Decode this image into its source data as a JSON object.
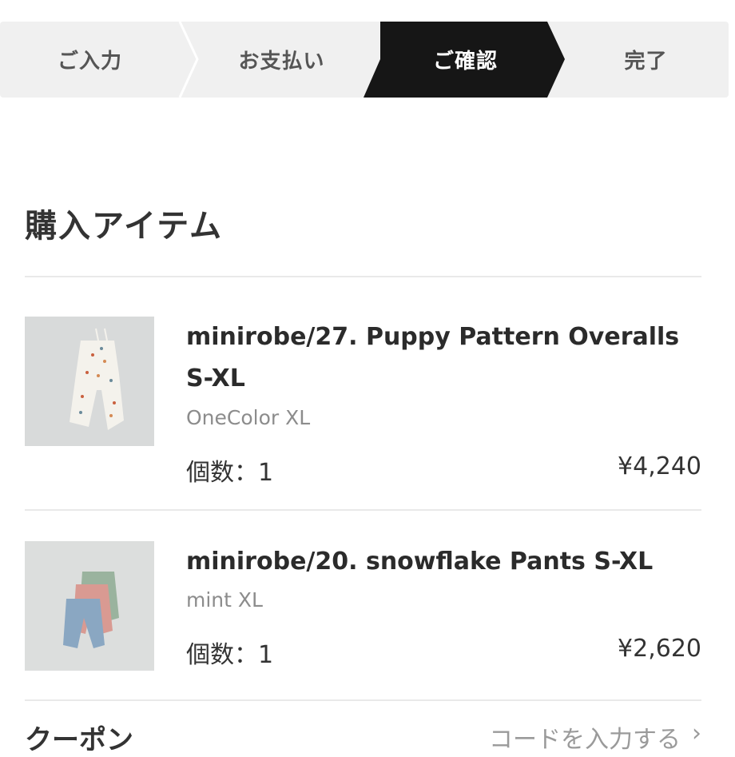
{
  "steps": [
    {
      "label": "ご入力",
      "active": false
    },
    {
      "label": "お支払い",
      "active": false
    },
    {
      "label": "ご確認",
      "active": true
    },
    {
      "label": "完了",
      "active": false
    }
  ],
  "section": {
    "title": "購入アイテム"
  },
  "items": [
    {
      "name": "minirobe/27. Puppy Pattern Overalls S-XL",
      "variant": "OneColor XL",
      "quantity": "個数：1",
      "price": "¥4,240"
    },
    {
      "name": "minirobe/20. snowflake Pants S-XL",
      "variant": "mint XL",
      "quantity": "個数：1",
      "price": "¥2,620"
    }
  ],
  "coupon": {
    "label": "クーポン",
    "placeholder": "コードを入力する",
    "chevron_icon": "chevron-right-icon"
  },
  "colors": {
    "active_step_bg": "#161616",
    "stepper_bg": "#f0f0f0",
    "divider": "#e9e9e9"
  }
}
